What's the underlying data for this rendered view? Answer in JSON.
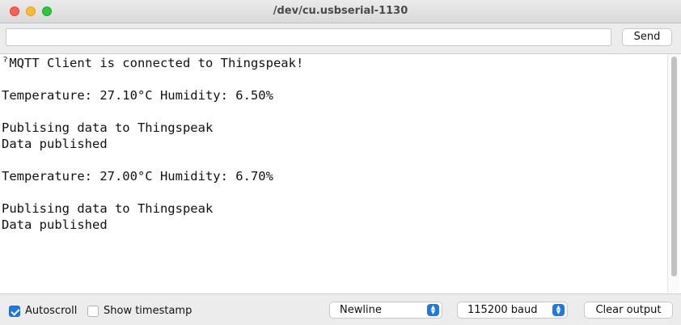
{
  "window": {
    "title": "/dev/cu.usbserial-1130"
  },
  "send": {
    "input_value": "",
    "button_label": "Send"
  },
  "output": {
    "lines": [
      "ˀMQTT Client is connected to Thingspeak!",
      "",
      "Temperature: 27.10°C Humidity: 6.50%",
      "",
      "Publising data to Thingspeak",
      "Data published",
      "",
      "Temperature: 27.00°C Humidity: 6.70%",
      "",
      "Publising data to Thingspeak",
      "Data published"
    ]
  },
  "footer": {
    "autoscroll_label": "Autoscroll",
    "autoscroll_checked": true,
    "timestamp_label": "Show timestamp",
    "timestamp_checked": false,
    "line_ending": "Newline",
    "baud_rate": "115200 baud",
    "clear_label": "Clear output"
  },
  "colors": {
    "accent": "#1f7ae0",
    "close": "#ff5f57",
    "minimize": "#febc2e",
    "maximize": "#28c840"
  }
}
